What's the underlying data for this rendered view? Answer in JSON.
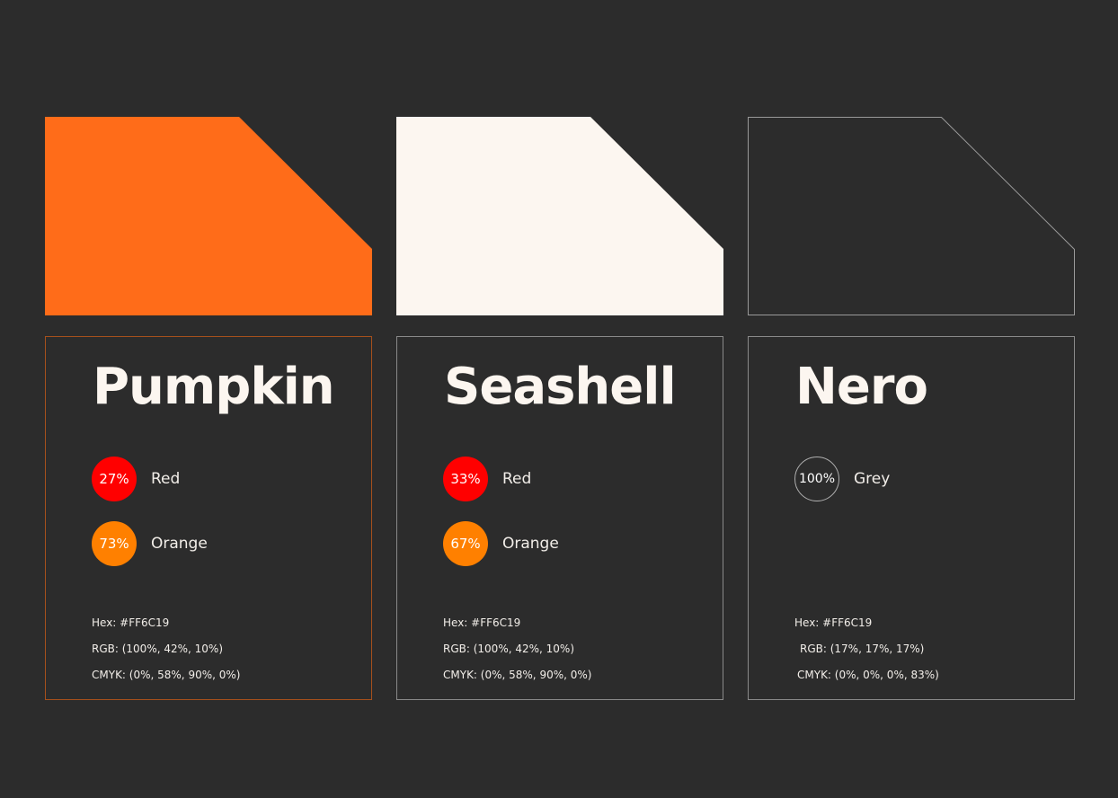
{
  "colors": [
    {
      "name": "Pumpkin",
      "swatch_color": "#ff6c19",
      "card_border_color": "#a6501c",
      "mix": [
        {
          "percent": "27%",
          "label": "Red",
          "badge_color": "#ff0000"
        },
        {
          "percent": "73%",
          "label": "Orange",
          "badge_color": "#ff8000"
        }
      ],
      "hex": "Hex: #FF6C19",
      "rgb": "RGB: (100%, 42%, 10%)",
      "cmyk": "CMYK: (0%, 58%, 90%, 0%)"
    },
    {
      "name": "Seashell",
      "swatch_color": "#fcf6f0",
      "card_border_color": "#8a8a8a",
      "mix": [
        {
          "percent": "33%",
          "label": "Red",
          "badge_color": "#ff0000"
        },
        {
          "percent": "67%",
          "label": "Orange",
          "badge_color": "#ff8000"
        }
      ],
      "hex": "Hex: #FF6C19",
      "rgb": "RGB: (100%, 42%, 10%)",
      "cmyk": "CMYK: (0%, 58%, 90%, 0%)"
    },
    {
      "name": "Nero",
      "swatch_color": "#2c2c2c",
      "swatch_outline_color": "#9a9a9a",
      "card_border_color": "#8a8a8a",
      "mix": [
        {
          "percent": "100%",
          "label": "Grey",
          "badge_color": "#2c2c2c",
          "badge_outline_color": "#b0b0b0"
        }
      ],
      "hex": "Hex: #FF6C19",
      "rgb": "RGB: (17%, 17%, 17%)",
      "cmyk": "CMYK: (0%, 0%, 0%, 83%)"
    }
  ]
}
